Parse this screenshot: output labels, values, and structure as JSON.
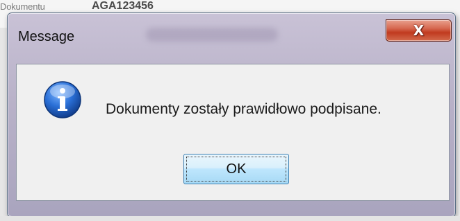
{
  "background": {
    "field_label": "Dokumentu",
    "field_value": "AGA123456"
  },
  "dialog": {
    "title": "Message",
    "close_glyph": "X",
    "message": "Dokumenty zostały prawidłowo podpisane.",
    "icon": "information-icon",
    "ok_label": "OK"
  },
  "colors": {
    "close_button": "#c83f22",
    "ok_button_border": "#3c7fb1",
    "icon_blue": "#1b5fc2"
  }
}
